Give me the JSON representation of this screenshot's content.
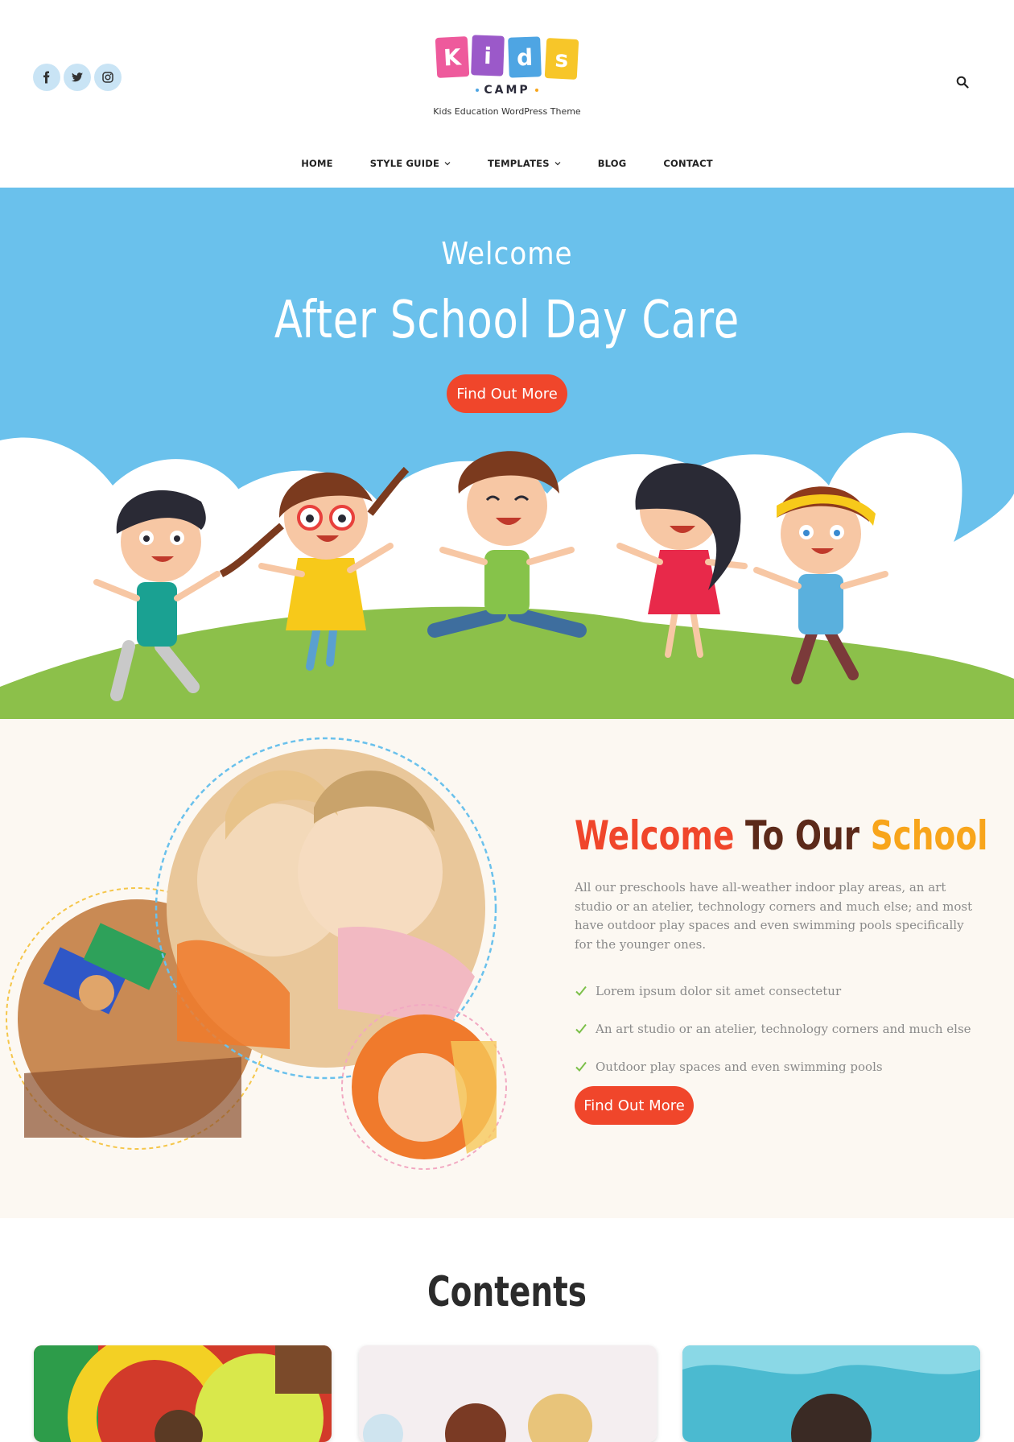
{
  "header": {
    "social": [
      {
        "name": "facebook",
        "icon": "facebook-icon"
      },
      {
        "name": "twitter",
        "icon": "twitter-icon"
      },
      {
        "name": "instagram",
        "icon": "instagram-icon"
      }
    ],
    "logo": {
      "letters": [
        "K",
        "i",
        "d",
        "s"
      ],
      "letter_colors": [
        "#ee5a9c",
        "#9b59c9",
        "#4ea5e3",
        "#f7c629"
      ],
      "sub": "CAMP",
      "tagline": "Kids Education WordPress Theme"
    },
    "search_icon": "search-icon"
  },
  "nav": {
    "items": [
      {
        "label": "HOME",
        "has_dropdown": false
      },
      {
        "label": "STYLE GUIDE",
        "has_dropdown": true
      },
      {
        "label": "TEMPLATES",
        "has_dropdown": true
      },
      {
        "label": "BLOG",
        "has_dropdown": false
      },
      {
        "label": "CONTACT",
        "has_dropdown": false
      }
    ]
  },
  "hero": {
    "kicker": "Welcome",
    "title": "After School Day Care",
    "button": "Find Out More",
    "colors": {
      "sky": "#6ac1ec",
      "grass": "#8cc04a",
      "cloud": "#ffffff",
      "button": "#f0462b"
    }
  },
  "welcome": {
    "title_parts": [
      "Welcome",
      "To Our",
      "School"
    ],
    "text": "All our preschools have all-weather indoor play areas, an art studio or an atelier, technology corners and much else; and most have outdoor play spaces and even swimming pools specifically for the younger ones.",
    "checklist": [
      "Lorem ipsum dolor sit amet consectetur",
      "An art studio or an atelier, technology corners and much else",
      "Outdoor play spaces and even swimming pools"
    ],
    "button": "Find Out More",
    "colors": {
      "title_1": "#f0462b",
      "title_2": "#5c2a1a",
      "title_3": "#f8a51b",
      "check": "#7cc04a"
    }
  },
  "contents": {
    "title": "Contents"
  }
}
